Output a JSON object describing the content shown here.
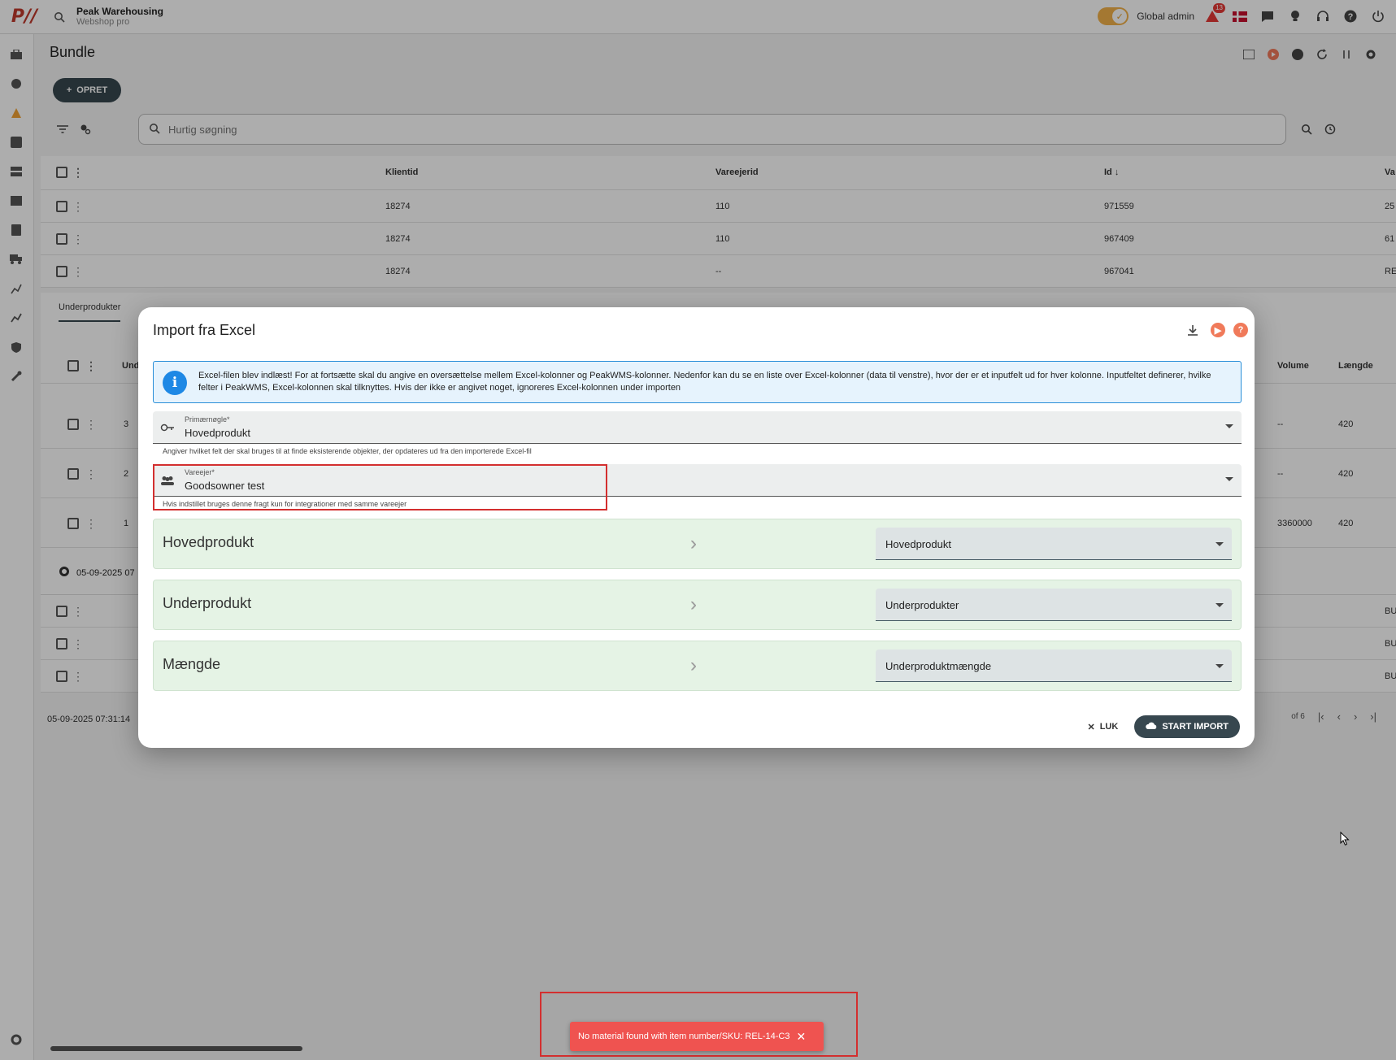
{
  "app": {
    "brand_name": "Peak Warehousing",
    "brand_sub": "Webshop pro",
    "admin_label": "Global admin",
    "notification_count": "13"
  },
  "page": {
    "title": "Bundle",
    "create_label": "OPRET",
    "search_placeholder": "Hurtig søgning"
  },
  "table": {
    "columns": [
      "Klientid",
      "Vareejerid",
      "Id",
      "Va"
    ],
    "rows": [
      {
        "klient": "18274",
        "vareejer": "110",
        "id": "971559",
        "va": "25"
      },
      {
        "klient": "18274",
        "vareejer": "110",
        "id": "967409",
        "va": "61"
      },
      {
        "klient": "18274",
        "vareejer": "--",
        "id": "967041",
        "va": "RE"
      }
    ],
    "lower_rows": [
      {
        "va": "BU"
      },
      {
        "va": "BU"
      },
      {
        "va": "BU"
      }
    ]
  },
  "subpanel": {
    "tab": "Underprodukter",
    "col_und": "Und",
    "col_volume": "Volume",
    "col_length": "Længde",
    "rows": [
      {
        "und": "3",
        "volume": "--",
        "length": "420"
      },
      {
        "und": "2",
        "volume": "--",
        "length": "420"
      },
      {
        "und": "1",
        "volume": "3360000",
        "length": "420"
      }
    ],
    "footer_date": "05-09-2025 07"
  },
  "bottom": {
    "date": "05-09-2025 07:31:14",
    "page_of": "of 6"
  },
  "dialog": {
    "title": "Import fra Excel",
    "info": "Excel-filen blev indlæst! For at fortsætte skal du angive en oversættelse mellem Excel-kolonner og PeakWMS-kolonner. Nedenfor kan du se en liste over Excel-kolonner (data til venstre), hvor der er et inputfelt ud for hver kolonne. Inputfeltet definerer, hvilke felter i PeakWMS, Excel-kolonnen skal tilknyttes. Hvis der ikke er angivet noget, ignoreres Excel-kolonnen under importen",
    "primary_key": {
      "label": "Primærnøgle*",
      "value": "Hovedprodukt",
      "hint": "Angiver hvilket felt der skal bruges til at finde eksisterende objekter, der opdateres ud fra den importerede Excel-fil"
    },
    "owner": {
      "label": "Vareejer*",
      "value": "Goodsowner test",
      "hint": "Hvis indstillet bruges denne fragt kun for integrationer med samme vareejer"
    },
    "mappings": [
      {
        "excel": "Hovedprodukt",
        "target": "Hovedprodukt"
      },
      {
        "excel": "Underprodukt",
        "target": "Underprodukter"
      },
      {
        "excel": "Mængde",
        "target": "Underproduktmængde"
      }
    ],
    "close_label": "LUK",
    "import_label": "START IMPORT"
  },
  "toast": {
    "message": "No material found with item number/SKU: REL-14-C3"
  },
  "colors": {
    "accent": "#37474f",
    "error": "#ef5350",
    "info": "#1e88e5",
    "mapping_bg": "#e5f3e5"
  }
}
